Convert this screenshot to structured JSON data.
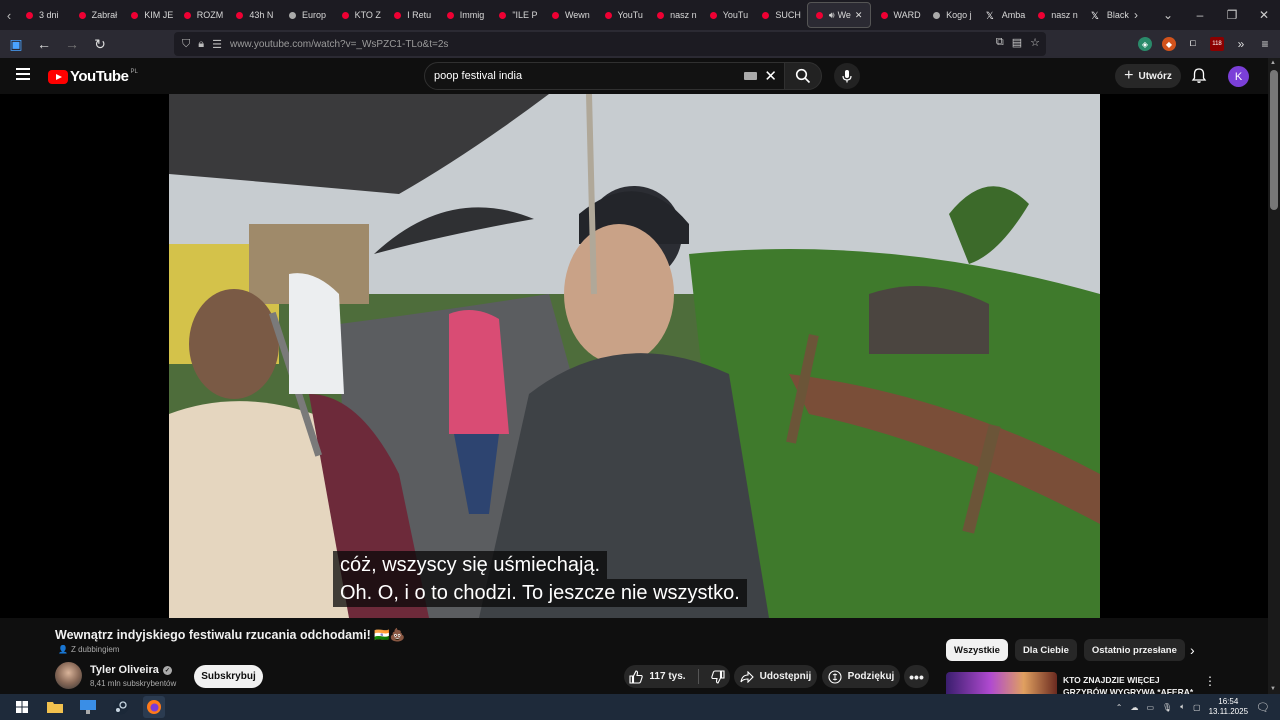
{
  "browser": {
    "tabs": [
      {
        "label": "3 dni",
        "icon": "youtube-icon"
      },
      {
        "label": "Zabrał",
        "icon": "youtube-icon"
      },
      {
        "label": "KIM JE",
        "icon": "youtube-icon"
      },
      {
        "label": "ROZM",
        "icon": "youtube-icon"
      },
      {
        "label": "43h N",
        "icon": "youtube-icon"
      },
      {
        "label": "Europ",
        "icon": "globe-icon"
      },
      {
        "label": "KTO Z",
        "icon": "youtube-icon"
      },
      {
        "label": "I Retu",
        "icon": "youtube-icon"
      },
      {
        "label": "Immig",
        "icon": "youtube-icon"
      },
      {
        "label": "\"ILE P",
        "icon": "youtube-icon"
      },
      {
        "label": "Wewn",
        "icon": "youtube-icon"
      },
      {
        "label": "YouTu",
        "icon": "youtube-icon"
      },
      {
        "label": "nasz n",
        "icon": "youtube-icon"
      },
      {
        "label": "YouTu",
        "icon": "youtube-icon"
      },
      {
        "label": "SUCH",
        "icon": "youtube-icon"
      },
      {
        "label": "We",
        "icon": "youtube-icon",
        "active": true
      },
      {
        "label": "WARD",
        "icon": "youtube-icon"
      },
      {
        "label": "Kogo j",
        "icon": "globe-icon"
      },
      {
        "label": "Amba",
        "icon": "x-icon"
      },
      {
        "label": "nasz n",
        "icon": "youtube-icon"
      },
      {
        "label": "Black",
        "icon": "x-icon"
      }
    ],
    "url": "www.youtube.com/watch?v=_WsPZC1-TLo&t=2s",
    "extension_badge": "118"
  },
  "youtube": {
    "logo_text": "YouTube",
    "region": "PL",
    "search_query": "poop festival india",
    "create_label": "Utwórz",
    "avatar_letter": "K"
  },
  "video": {
    "subtitle_line1": "cóż, wszyscy się uśmiechają.",
    "subtitle_line2": "Oh.  O, i o to chodzi.  To jeszcze nie wszystko."
  },
  "info": {
    "title": "Wewnątrz indyjskiego festiwalu rzucania odchodami! 🇮🇳💩",
    "dubbing": "Z dubbingiem",
    "channel_name": "Tyler Oliveira",
    "subscribers": "8,41 mln subskrybentów",
    "subscribe_label": "Subskrybuj",
    "likes": "117 tys.",
    "share_label": "Udostępnij",
    "thanks_label": "Podziękuj"
  },
  "recommendations": {
    "chips": [
      "Wszystkie",
      "Dla Ciebie",
      "Ostatnio przesłane"
    ],
    "first_title": "KTO ZNAJDZIE WIĘCEJ GRZYBÓW WYGRYWA *AFERA*"
  },
  "taskbar": {
    "time": "16:54",
    "date": "13.11.2025"
  }
}
